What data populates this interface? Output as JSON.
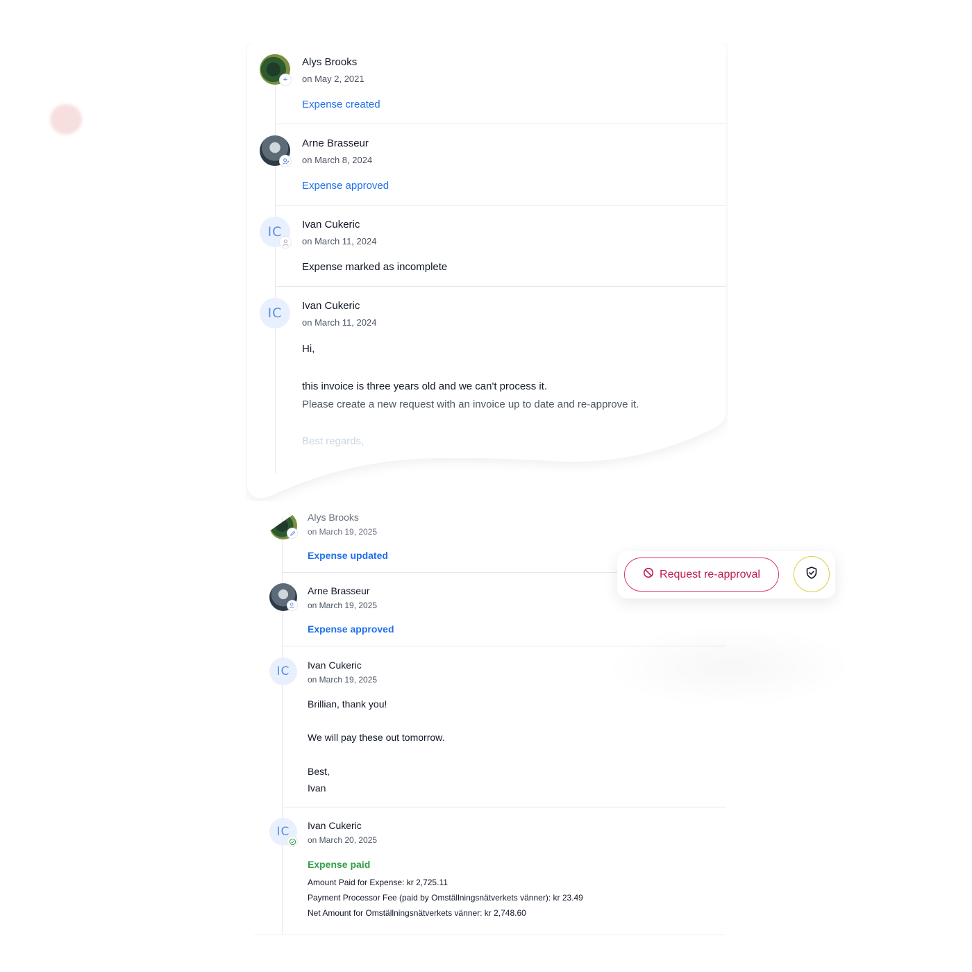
{
  "top_card": {
    "entries": [
      {
        "name": "Alys Brooks",
        "date": "on May 2, 2021",
        "action": "Expense created",
        "avatar": "photo",
        "badge_icon": "plus-icon"
      },
      {
        "name": "Arne Brasseur",
        "date": "on March 8, 2024",
        "action": "Expense approved",
        "avatar": "photo",
        "badge_icon": "user-check-icon"
      },
      {
        "name": "Ivan Cukeric",
        "initials": "IC",
        "date": "on March 11, 2024",
        "action": "Expense marked as incomplete",
        "badge_icon": "user-icon"
      },
      {
        "name": "Ivan Cukeric",
        "initials": "IC",
        "date": "on March 11, 2024",
        "message": {
          "greeting": "Hi,",
          "line1": "this invoice is three years old and we can't process it.",
          "line2": "Please create a new request with an invoice up to date and re-approve it.",
          "closing": "Best regards,"
        }
      }
    ]
  },
  "bottom_list": {
    "entries": [
      {
        "name": "Alys Brooks",
        "date": "on March 19, 2025",
        "action": "Expense updated",
        "badge_icon": "edit-icon"
      },
      {
        "name": "Arne Brasseur",
        "date": "on March 19, 2025",
        "action": "Expense approved",
        "badge_icon": "user-check-icon"
      },
      {
        "name": "Ivan Cukeric",
        "initials": "IC",
        "date": "on March 19, 2025",
        "message": {
          "line1": "Brillian, thank you!",
          "line2": "We will pay these out tomorrow.",
          "line3": "Best,",
          "line4": "Ivan"
        }
      },
      {
        "name": "Ivan Cukeric",
        "initials": "IC",
        "date": "on March 20, 2025",
        "action": "Expense paid",
        "badge_icon": "check-circle-icon",
        "details": {
          "amount_paid": "Amount Paid for Expense: kr 2,725.11",
          "processor_fee": "Payment Processor Fee (paid by Omställningsnätverkets vänner): kr 23.49",
          "net_amount": "Net Amount for Omställningsnätverkets vänner: kr 2,748.60"
        }
      }
    ]
  },
  "action_bar": {
    "reapprove_label": "Request re-approval",
    "reapprove_icon": "ban-icon",
    "shield_icon": "shield-check-icon"
  },
  "colors": {
    "link_blue": "#1f6feb",
    "paid_green": "#2f9e44",
    "reapprove_red": "#c01c4b",
    "shield_ring": "#d7d03c"
  }
}
